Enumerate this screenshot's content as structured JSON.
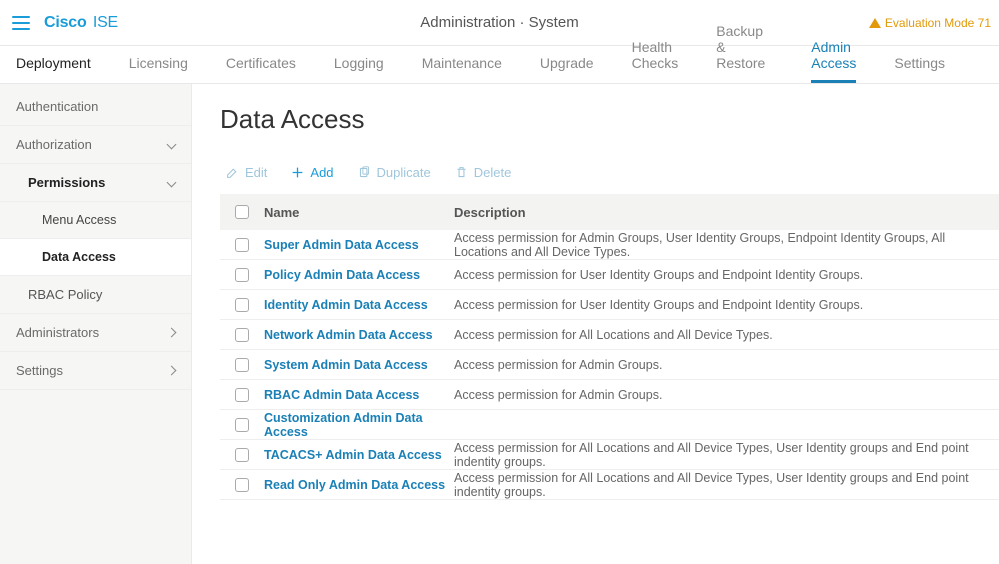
{
  "header": {
    "brand_main": "Cisco",
    "brand_sub": "ISE",
    "breadcrumb": "Administration · System",
    "eval_text": "Evaluation Mode 71"
  },
  "tabs": [
    {
      "label": "Deployment",
      "state": "parent"
    },
    {
      "label": "Licensing",
      "state": ""
    },
    {
      "label": "Certificates",
      "state": ""
    },
    {
      "label": "Logging",
      "state": ""
    },
    {
      "label": "Maintenance",
      "state": ""
    },
    {
      "label": "Upgrade",
      "state": ""
    },
    {
      "label": "Health Checks",
      "state": ""
    },
    {
      "label": "Backup & Restore",
      "state": ""
    },
    {
      "label": "Admin Access",
      "state": "active"
    },
    {
      "label": "Settings",
      "state": ""
    }
  ],
  "sidebar": {
    "items": [
      {
        "label": "Authentication",
        "level": 1,
        "chev": "",
        "selected": false
      },
      {
        "label": "Authorization",
        "level": 1,
        "chev": "down",
        "selected": false
      },
      {
        "label": "Permissions",
        "level": 2,
        "chev": "down",
        "selected": false,
        "bold": true
      },
      {
        "label": "Menu Access",
        "level": 3,
        "chev": "",
        "selected": false
      },
      {
        "label": "Data Access",
        "level": 3,
        "chev": "",
        "selected": true
      },
      {
        "label": "RBAC Policy",
        "level": 2,
        "chev": "",
        "selected": false
      },
      {
        "label": "Administrators",
        "level": 1,
        "chev": "right",
        "selected": false
      },
      {
        "label": "Settings",
        "level": 1,
        "chev": "right",
        "selected": false
      }
    ]
  },
  "page": {
    "title": "Data Access"
  },
  "toolbar": {
    "edit": "Edit",
    "add": "Add",
    "duplicate": "Duplicate",
    "delete": "Delete"
  },
  "table": {
    "headers": {
      "name": "Name",
      "description": "Description"
    },
    "rows": [
      {
        "name": "Super Admin Data Access",
        "description": "Access permission for Admin Groups, User Identity Groups, Endpoint Identity Groups, All Locations and All Device Types."
      },
      {
        "name": "Policy Admin Data Access",
        "description": "Access permission for User Identity Groups and Endpoint Identity Groups."
      },
      {
        "name": "Identity Admin Data Access",
        "description": "Access permission for User Identity Groups and Endpoint Identity Groups."
      },
      {
        "name": "Network Admin Data Access",
        "description": "Access permission for All Locations and All Device Types."
      },
      {
        "name": "System Admin Data Access",
        "description": "Access permission for Admin Groups."
      },
      {
        "name": "RBAC Admin Data Access",
        "description": "Access permission for Admin Groups."
      },
      {
        "name": "Customization Admin Data Access",
        "description": ""
      },
      {
        "name": "TACACS+ Admin Data Access",
        "description": "Access permission for All Locations and All Device Types, User Identity groups and End point indentity groups."
      },
      {
        "name": "Read Only Admin Data Access",
        "description": "Access permission for All Locations and All Device Types, User Identity groups and End point indentity groups."
      }
    ]
  }
}
